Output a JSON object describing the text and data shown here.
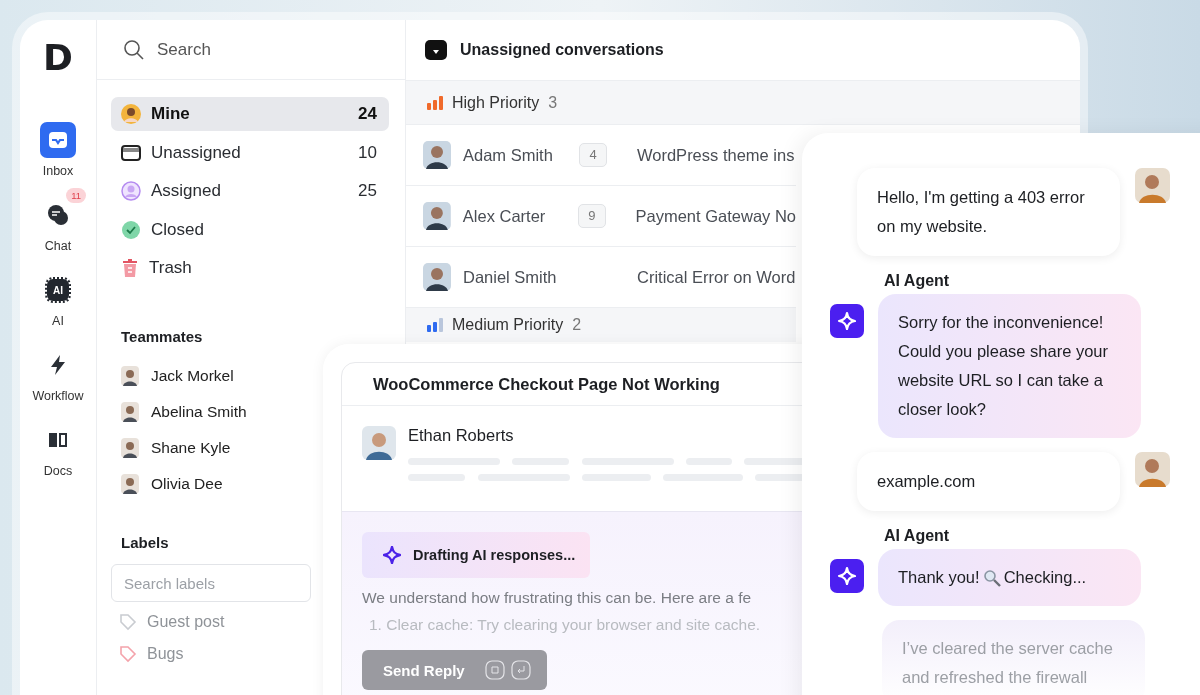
{
  "rail": {
    "logo": "D",
    "items": [
      {
        "label": "Inbox",
        "kind": "inbox",
        "selected": true
      },
      {
        "label": "Chat",
        "kind": "chat",
        "selected": false,
        "badge": "11"
      },
      {
        "label": "AI",
        "kind": "ai",
        "selected": false,
        "icon_text": "AI"
      },
      {
        "label": "Workflow",
        "kind": "workflow",
        "selected": false
      },
      {
        "label": "Docs",
        "kind": "docs",
        "selected": false
      }
    ]
  },
  "search": {
    "placeholder": "Search"
  },
  "folders": [
    {
      "label": "Mine",
      "count": "24",
      "kind": "mine",
      "selected": true
    },
    {
      "label": "Unassigned",
      "count": "10",
      "kind": "unassigned",
      "selected": false
    },
    {
      "label": "Assigned",
      "count": "25",
      "kind": "assigned",
      "selected": false
    },
    {
      "label": "Closed",
      "kind": "closed",
      "selected": false
    },
    {
      "label": "Trash",
      "kind": "trash",
      "selected": false
    }
  ],
  "teammates": {
    "title": "Teammates",
    "members": [
      {
        "name": "Jack Morkel"
      },
      {
        "name": "Abelina Smith"
      },
      {
        "name": "Shane Kyle"
      },
      {
        "name": "Olivia Dee"
      }
    ]
  },
  "labels": {
    "title": "Labels",
    "search_placeholder": "Search labels",
    "items": [
      {
        "name": "Guest post",
        "color": "#c9ccd1"
      },
      {
        "name": "Bugs",
        "color": "#f4a3ab"
      }
    ]
  },
  "conversations": {
    "title": "Unassigned conversations",
    "groups": [
      {
        "name": "High Priority",
        "count": "3",
        "kind": "high",
        "rows": [
          {
            "name": "Adam Smith",
            "unread": "4",
            "subject": "WordPress theme ins"
          },
          {
            "name": "Alex Carter",
            "unread": "9",
            "subject": "Payment Gateway No"
          },
          {
            "name": "Daniel Smith",
            "subject": "Critical Error on Word"
          }
        ]
      },
      {
        "name": "Medium Priority",
        "count": "2",
        "kind": "medium"
      }
    ]
  },
  "ticket": {
    "title": "WooCommerce Checkout Page Not Working",
    "author": "Ethan Roberts",
    "ai_status": "Drafting AI responses...",
    "draft": "We understand how frustrating this can be. Here are a fe",
    "steps": [
      "1. Clear cache: Try clearing your browser and site cache."
    ],
    "send_button": "Send Reply"
  },
  "chat": {
    "messages": [
      {
        "kind": "customer",
        "text": "Hello, I'm getting a 403 error on my website."
      },
      {
        "kind": "agent",
        "sender": "AI Agent",
        "text": "Sorry for the inconvenience! Could you please share your website URL so I can take a closer look?"
      },
      {
        "kind": "customer",
        "text": "example.com"
      },
      {
        "kind": "agent_search",
        "sender": "AI Agent",
        "text": "Thank you!",
        "text_after": "Checking..."
      },
      {
        "kind": "agent_faded",
        "text": "I’ve cleared the server cache and refreshed the firewall"
      }
    ]
  }
}
